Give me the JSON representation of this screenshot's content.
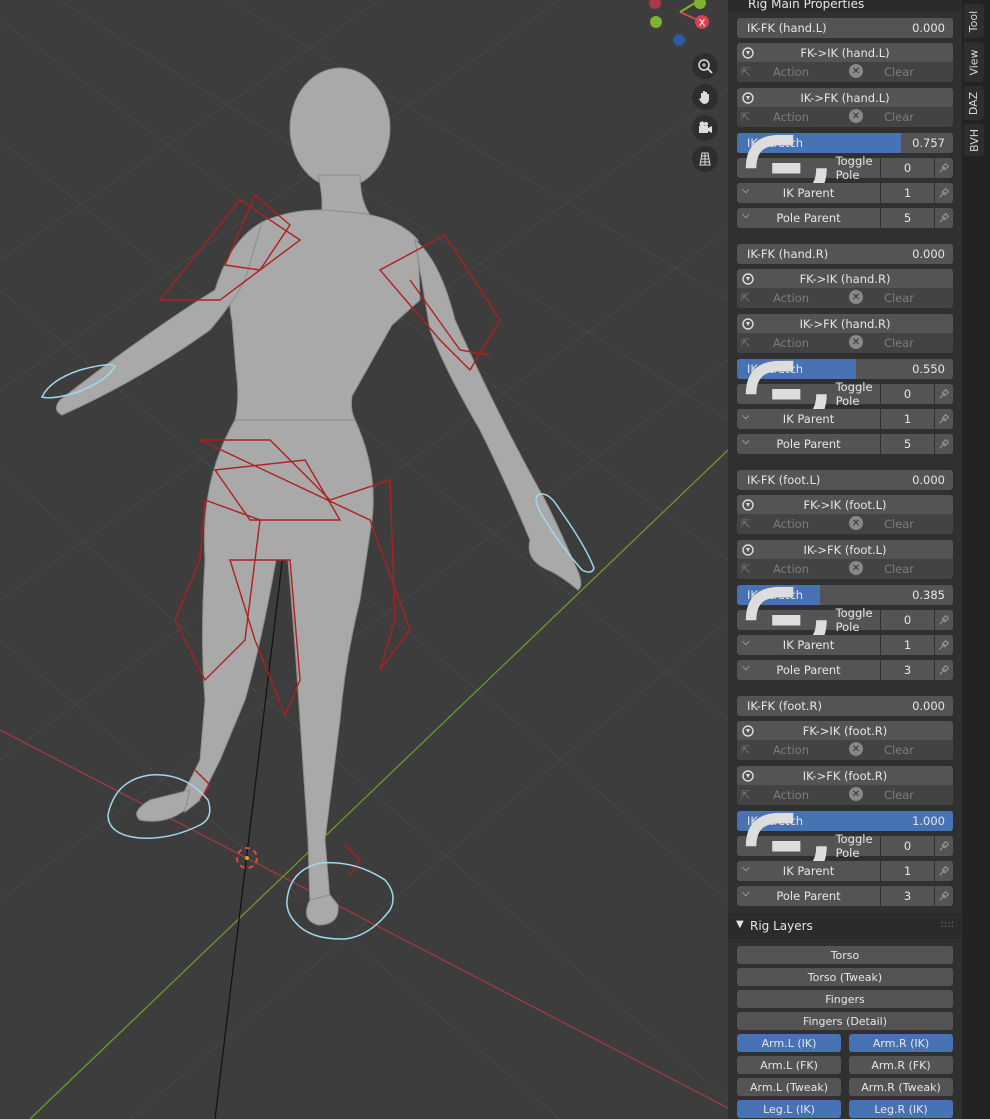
{
  "header": {
    "panel_title": "Rig Main Properties"
  },
  "tabs": [
    "Tool",
    "View",
    "DAZ",
    "BVH"
  ],
  "limbs": [
    {
      "ikfk_label": "IK-FK (hand.L)",
      "ikfk_value": "0.000",
      "fk_to_ik": "FK->IK (hand.L)",
      "ik_to_fk": "IK->FK (hand.L)",
      "stretch_value": "0.757",
      "stretch_fraction": 0.757,
      "pole_value": "0",
      "ik_parent_value": "1",
      "pole_parent_value": "5"
    },
    {
      "ikfk_label": "IK-FK (hand.R)",
      "ikfk_value": "0.000",
      "fk_to_ik": "FK->IK (hand.R)",
      "ik_to_fk": "IK->FK (hand.R)",
      "stretch_value": "0.550",
      "stretch_fraction": 0.55,
      "pole_value": "0",
      "ik_parent_value": "1",
      "pole_parent_value": "5"
    },
    {
      "ikfk_label": "IK-FK (foot.L)",
      "ikfk_value": "0.000",
      "fk_to_ik": "FK->IK (foot.L)",
      "ik_to_fk": "IK->FK (foot.L)",
      "stretch_value": "0.385",
      "stretch_fraction": 0.385,
      "pole_value": "0",
      "ik_parent_value": "1",
      "pole_parent_value": "3"
    },
    {
      "ikfk_label": "IK-FK (foot.R)",
      "ikfk_value": "0.000",
      "fk_to_ik": "FK->IK (foot.R)",
      "ik_to_fk": "IK->FK (foot.R)",
      "stretch_value": "1.000",
      "stretch_fraction": 1.0,
      "pole_value": "0",
      "ik_parent_value": "1",
      "pole_parent_value": "3"
    }
  ],
  "labels": {
    "action": "Action",
    "clear": "Clear",
    "ik_stretch": "IK Stretch",
    "toggle_pole": "Toggle Pole",
    "ik_parent": "IK Parent",
    "pole_parent": "Pole Parent"
  },
  "rig_layers": {
    "title": "Rig Layers",
    "full": [
      "Torso",
      "Torso (Tweak)",
      "Fingers",
      "Fingers (Detail)"
    ],
    "pairs": [
      {
        "left": "Arm.L (IK)",
        "right": "Arm.R (IK)",
        "on": true
      },
      {
        "left": "Arm.L (FK)",
        "right": "Arm.R (FK)",
        "on": false
      },
      {
        "left": "Arm.L (Tweak)",
        "right": "Arm.R (Tweak)",
        "on": false
      },
      {
        "left": "Leg.L (IK)",
        "right": "Leg.R (IK)",
        "on": true
      }
    ]
  },
  "colors": {
    "accent": "#4772b3",
    "bone_red": "#b01f1f",
    "control_cyan": "#9fd8ec",
    "x_axis": "#d9434f",
    "y_axis": "#7fb22f"
  },
  "viewport": {
    "navigation_icons": [
      "zoom-icon",
      "hand-pan-icon",
      "camera-icon",
      "grid-icon"
    ]
  }
}
